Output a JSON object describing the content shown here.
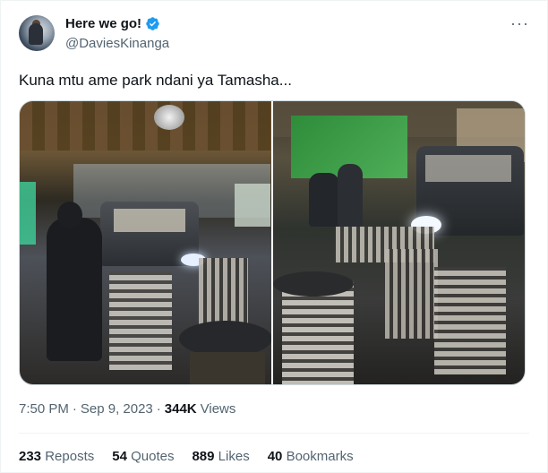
{
  "author": {
    "display_name": "Here we go!",
    "handle": "@DaviesKinanga",
    "verified": true,
    "avatar_icon": "profile-photo"
  },
  "tweet": {
    "text": "Kuna mtu ame park ndani ya Tamasha..."
  },
  "media": [
    {
      "icon": "photo-suv-inside-bar-left"
    },
    {
      "icon": "photo-suv-inside-bar-right"
    }
  ],
  "meta": {
    "time": "7:50 PM",
    "separator": "·",
    "date": "Sep 9, 2023",
    "views_count": "344K",
    "views_label": "Views"
  },
  "stats": {
    "reposts_count": "233",
    "reposts_label": "Reposts",
    "quotes_count": "54",
    "quotes_label": "Quotes",
    "likes_count": "889",
    "likes_label": "Likes",
    "bookmarks_count": "40",
    "bookmarks_label": "Bookmarks"
  },
  "colors": {
    "verified": "#1d9bf0",
    "secondary_text": "#536471",
    "primary_text": "#0f1419"
  }
}
